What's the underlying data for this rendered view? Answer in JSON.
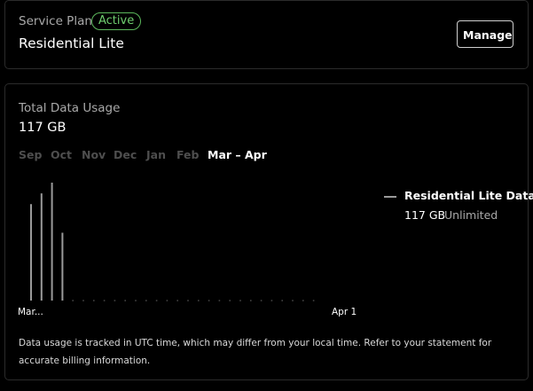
{
  "plan": {
    "label": "Service Plan",
    "status": "Active",
    "name": "Residential Lite",
    "manage_label": "Manage"
  },
  "usage": {
    "label": "Total Data Usage",
    "total": "117 GB",
    "tabs": [
      {
        "label": "Sep",
        "selected": false
      },
      {
        "label": "Oct",
        "selected": false
      },
      {
        "label": "Nov",
        "selected": false
      },
      {
        "label": "Dec",
        "selected": false
      },
      {
        "label": "Jan",
        "selected": false
      },
      {
        "label": "Feb",
        "selected": false
      },
      {
        "label": "Mar – Apr",
        "selected": true
      }
    ],
    "legend": {
      "name": "Residential Lite Data",
      "value": "117 GB",
      "limit": "Unlimited"
    },
    "footnote": "Data usage is tracked in UTC time, which may differ from your local time. Refer to your statement for accurate billing information."
  },
  "colors": {
    "background": "#000000",
    "border": "#2b2b2b",
    "active_green": "#6fcf6f",
    "muted_text": "#a9a9a9",
    "inactive_tab": "#4e4e4e",
    "bar": "#9a9a9a"
  },
  "chart_data": {
    "type": "bar",
    "x_start_label": "Mar...",
    "x_end_label": "Apr 1",
    "tick_labels": [
      "Mar...",
      "Apr 1"
    ],
    "series": [
      {
        "name": "Residential Lite Data",
        "values": [
          27,
          30,
          33,
          19,
          0,
          0,
          0,
          0,
          0,
          0,
          0,
          0,
          0,
          0,
          0,
          0,
          0,
          0,
          0,
          0,
          0,
          0,
          0,
          0,
          0,
          0,
          0,
          0
        ]
      }
    ],
    "unit": "GB",
    "ylim": [
      0,
      35
    ],
    "grid": false,
    "legend_position": "right"
  }
}
